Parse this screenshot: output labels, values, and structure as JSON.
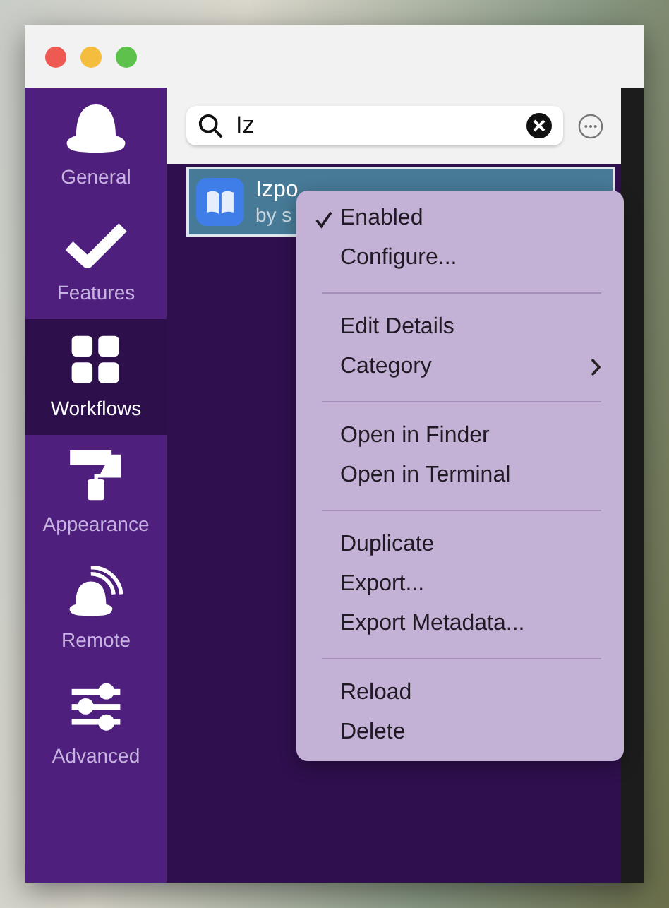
{
  "sidebar": {
    "items": [
      {
        "label": "General",
        "selected": false
      },
      {
        "label": "Features",
        "selected": false
      },
      {
        "label": "Workflows",
        "selected": true
      },
      {
        "label": "Appearance",
        "selected": false
      },
      {
        "label": "Remote",
        "selected": false
      },
      {
        "label": "Advanced",
        "selected": false
      }
    ]
  },
  "search": {
    "value": "Iz"
  },
  "workflows": [
    {
      "title": "Izpo",
      "subtitle": "by s",
      "selected": true
    }
  ],
  "context_menu": {
    "items": [
      {
        "kind": "item",
        "label": "Enabled",
        "checked": true
      },
      {
        "kind": "item",
        "label": "Configure...",
        "checked": false
      },
      {
        "kind": "separator"
      },
      {
        "kind": "item",
        "label": "Edit Details",
        "checked": false
      },
      {
        "kind": "submenu",
        "label": "Category",
        "checked": false
      },
      {
        "kind": "separator"
      },
      {
        "kind": "item",
        "label": "Open in Finder",
        "checked": false
      },
      {
        "kind": "item",
        "label": "Open in Terminal",
        "checked": false
      },
      {
        "kind": "separator"
      },
      {
        "kind": "item",
        "label": "Duplicate",
        "checked": false
      },
      {
        "kind": "item",
        "label": "Export...",
        "checked": false
      },
      {
        "kind": "item",
        "label": "Export Metadata...",
        "checked": false
      },
      {
        "kind": "separator"
      },
      {
        "kind": "item",
        "label": "Reload",
        "checked": false
      },
      {
        "kind": "item",
        "label": "Delete",
        "checked": false
      }
    ]
  }
}
